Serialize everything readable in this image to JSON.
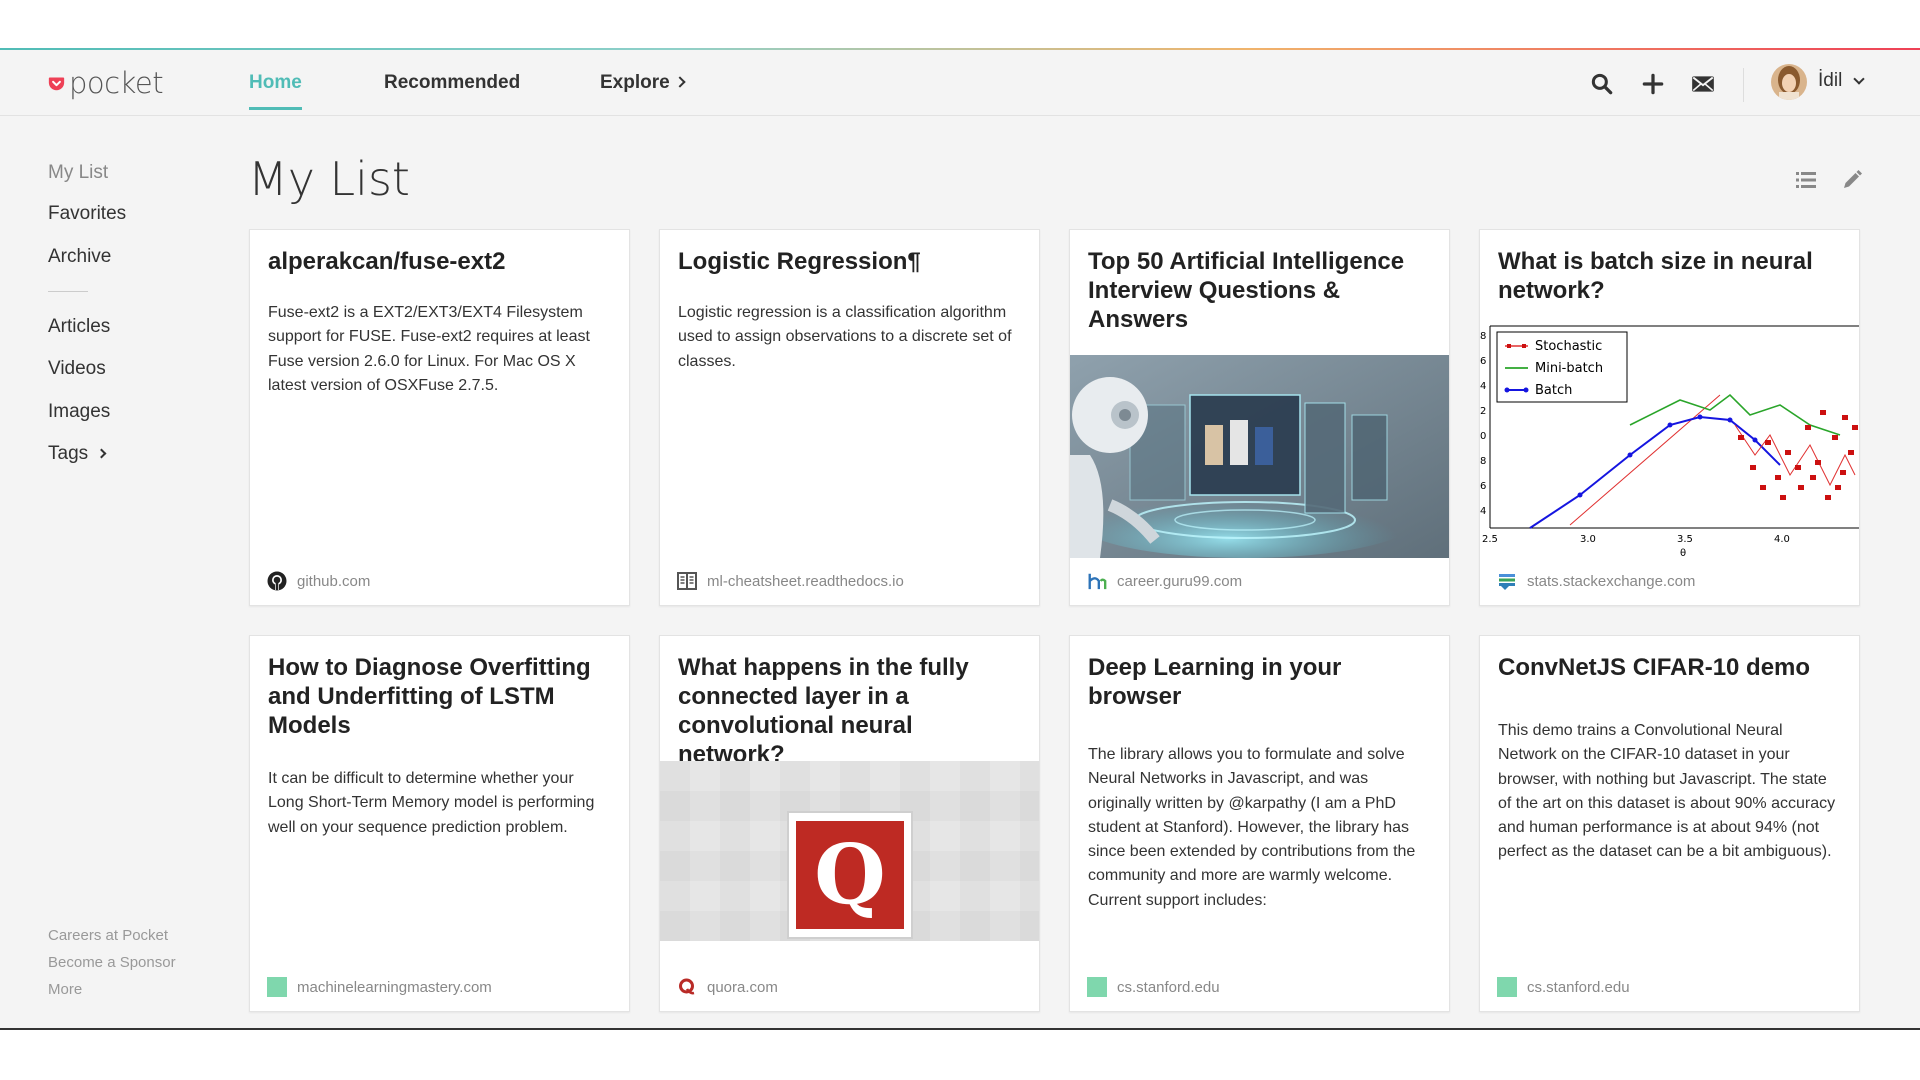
{
  "app": {
    "name": "pocket",
    "brand_color": "#ee4056",
    "accent_color": "#50bcb6"
  },
  "nav": {
    "tabs": [
      {
        "label": "Home",
        "active": true
      },
      {
        "label": "Recommended",
        "active": false
      },
      {
        "label": "Explore",
        "active": false
      }
    ],
    "icons": [
      "search-icon",
      "add-icon",
      "inbox-icon"
    ],
    "user": {
      "name": "İdil",
      "avatar": "avatar"
    }
  },
  "sidebar": {
    "items": [
      {
        "label": "My List",
        "active": true
      },
      {
        "label": "Favorites"
      },
      {
        "label": "Archive"
      }
    ],
    "filters": [
      {
        "label": "Articles"
      },
      {
        "label": "Videos"
      },
      {
        "label": "Images"
      },
      {
        "label": "Tags"
      }
    ],
    "footer": [
      "Careers at Pocket",
      "Become a Sponsor",
      "More"
    ]
  },
  "main": {
    "title": "My List",
    "tools": [
      "list-view-icon",
      "edit-icon"
    ],
    "cards": [
      {
        "title": "alperakcan/fuse-ext2",
        "excerpt": "Fuse-ext2 is a EXT2/EXT3/EXT4 Filesystem support for FUSE. Fuse-ext2 requires at least Fuse version 2.6.0 for Linux. For Mac OS X latest version of OSXFuse 2.7.5.",
        "domain": "github.com",
        "favicon": "github-icon"
      },
      {
        "title": "Logistic Regression¶",
        "excerpt": "Logistic regression is a classification algorithm used to assign observations to a discrete set of classes.",
        "domain": "ml-cheatsheet.readthedocs.io",
        "favicon": "readthedocs-icon"
      },
      {
        "title": "Top 50 Artificial Intelligence Interview Questions & Answers",
        "excerpt": "",
        "domain": "career.guru99.com",
        "favicon": "guru99-icon",
        "image": "robot-hologram-image"
      },
      {
        "title": "What is batch size in neural network?",
        "excerpt": "",
        "domain": "stats.stackexchange.com",
        "favicon": "stackexchange-icon",
        "image": "gradient-descent-plot-image",
        "plot": {
          "legend": [
            "Stochastic",
            "Mini-batch",
            "Batch"
          ],
          "y_ticks": [
            "8",
            "6",
            "4",
            "2",
            "0",
            "8",
            "6",
            "4"
          ],
          "x_ticks": [
            "2.5",
            "3.0",
            "3.5",
            "4.0"
          ],
          "x_label_partial": "θ"
        }
      },
      {
        "title": "How to Diagnose Overfitting and Underfitting of LSTM Models",
        "excerpt": "It can be difficult to determine whether your Long Short-Term Memory model is performing well on your sequence prediction problem.",
        "domain": "machinelearningmastery.com",
        "favicon": "green-square-icon"
      },
      {
        "title": "What happens in the fully connected layer in a convolutional neural network?",
        "excerpt": "",
        "domain": "quora.com",
        "favicon": "quora-icon",
        "image": "quora-logo-image",
        "image_letter": "Q"
      },
      {
        "title": "Deep Learning in your browser",
        "excerpt": "The library allows you to formulate and solve Neural Networks in Javascript, and was originally written by @karpathy (I am a PhD student at Stanford). However, the library has since been extended by contributions from the community and more are warmly welcome. Current support includes:",
        "domain": "cs.stanford.edu",
        "favicon": "green-square-icon"
      },
      {
        "title": "ConvNetJS CIFAR-10 demo",
        "excerpt": "This demo trains a Convolutional Neural Network on the CIFAR-10 dataset in your browser, with nothing but Javascript. The state of the art on this dataset is about 90% accuracy and human performance is at about 94% (not perfect as the dataset can be a bit ambiguous).",
        "domain": "cs.stanford.edu",
        "favicon": "green-square-icon"
      }
    ]
  }
}
